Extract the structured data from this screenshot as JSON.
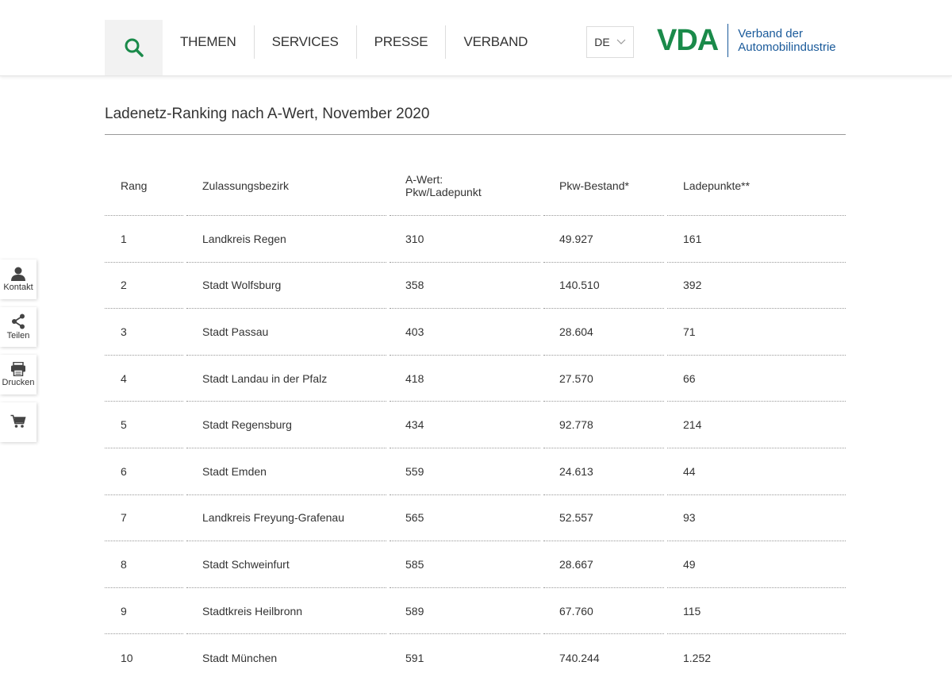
{
  "header": {
    "nav": [
      "THEMEN",
      "SERVICES",
      "PRESSE",
      "VERBAND"
    ],
    "language": "DE",
    "logo": {
      "mark": "VDA",
      "line1": "Verband der",
      "line2": "Automobilindustrie"
    },
    "colors": {
      "brand_green": "#1a8a4a",
      "brand_blue": "#1a5a9a"
    }
  },
  "sidebar": {
    "contact_label": "Kontakt",
    "share_label": "Teilen",
    "print_label": "Drucken",
    "icons": [
      "person-icon",
      "share-icon",
      "printer-icon",
      "cart-icon"
    ]
  },
  "page": {
    "title": "Ladenetz-Ranking nach A-Wert, November 2020"
  },
  "table": {
    "headers": {
      "rank": "Rang",
      "district": "Zulassungsbezirk",
      "a_value_line1": "A-Wert:",
      "a_value_line2": "Pkw/Ladepunkt",
      "cars": "Pkw-Bestand*",
      "charging_points": "Ladepunkte**"
    },
    "rows": [
      {
        "rank": "1",
        "district": "Landkreis Regen",
        "a_value": "310",
        "cars": "49.927",
        "points": "161"
      },
      {
        "rank": "2",
        "district": "Stadt Wolfsburg",
        "a_value": "358",
        "cars": "140.510",
        "points": "392"
      },
      {
        "rank": "3",
        "district": "Stadt Passau",
        "a_value": "403",
        "cars": "28.604",
        "points": "71"
      },
      {
        "rank": "4",
        "district": "Stadt Landau in der Pfalz",
        "a_value": "418",
        "cars": "27.570",
        "points": "66"
      },
      {
        "rank": "5",
        "district": "Stadt Regensburg",
        "a_value": "434",
        "cars": "92.778",
        "points": "214"
      },
      {
        "rank": "6",
        "district": "Stadt Emden",
        "a_value": "559",
        "cars": "24.613",
        "points": "44"
      },
      {
        "rank": "7",
        "district": "Landkreis Freyung-Grafenau",
        "a_value": "565",
        "cars": "52.557",
        "points": "93"
      },
      {
        "rank": "8",
        "district": "Stadt Schweinfurt",
        "a_value": "585",
        "cars": "28.667",
        "points": "49"
      },
      {
        "rank": "9",
        "district": "Stadtkreis Heilbronn",
        "a_value": "589",
        "cars": "67.760",
        "points": "115"
      },
      {
        "rank": "10",
        "district": "Stadt München",
        "a_value": "591",
        "cars": "740.244",
        "points": "1.252"
      }
    ]
  }
}
